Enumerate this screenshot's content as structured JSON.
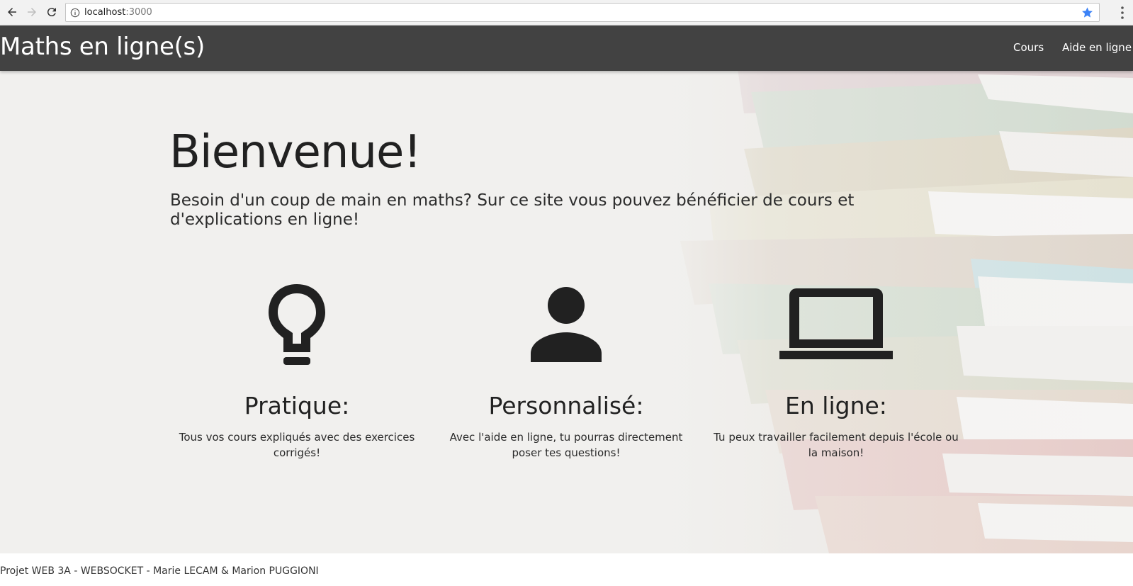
{
  "browser": {
    "url_host": "localhost",
    "url_port": ":3000",
    "icons": [
      "back-arrow-icon",
      "forward-arrow-icon",
      "reload-icon",
      "info-icon",
      "bookmark-star-icon",
      "browser-menu-icon"
    ],
    "star_color": "#3b82f6"
  },
  "navbar": {
    "brand": "Maths en ligne(s)",
    "links": [
      "Cours",
      "Aide en ligne"
    ],
    "background": "#424242"
  },
  "hero": {
    "title": "Bienvenue!",
    "subtitle": "Besoin d'un coup de main en maths? Sur ce site vous pouvez bénéficier de cours et d'explications en ligne!"
  },
  "features": [
    {
      "icon": "lightbulb-icon",
      "title": "Pratique:",
      "text": "Tous vos cours expliqués avec des exercices corrigés!"
    },
    {
      "icon": "person-icon",
      "title": "Personnalisé:",
      "text": "Avec l'aide en ligne, tu pourras directement poser tes questions!"
    },
    {
      "icon": "laptop-icon",
      "title": "En ligne:",
      "text": "Tu peux travailler facilement depuis l'école ou la maison!"
    }
  ],
  "footer": {
    "text": "Projet WEB 3A - WEBSOCKET - Marie LECAM & Marion PUGGIONI"
  }
}
